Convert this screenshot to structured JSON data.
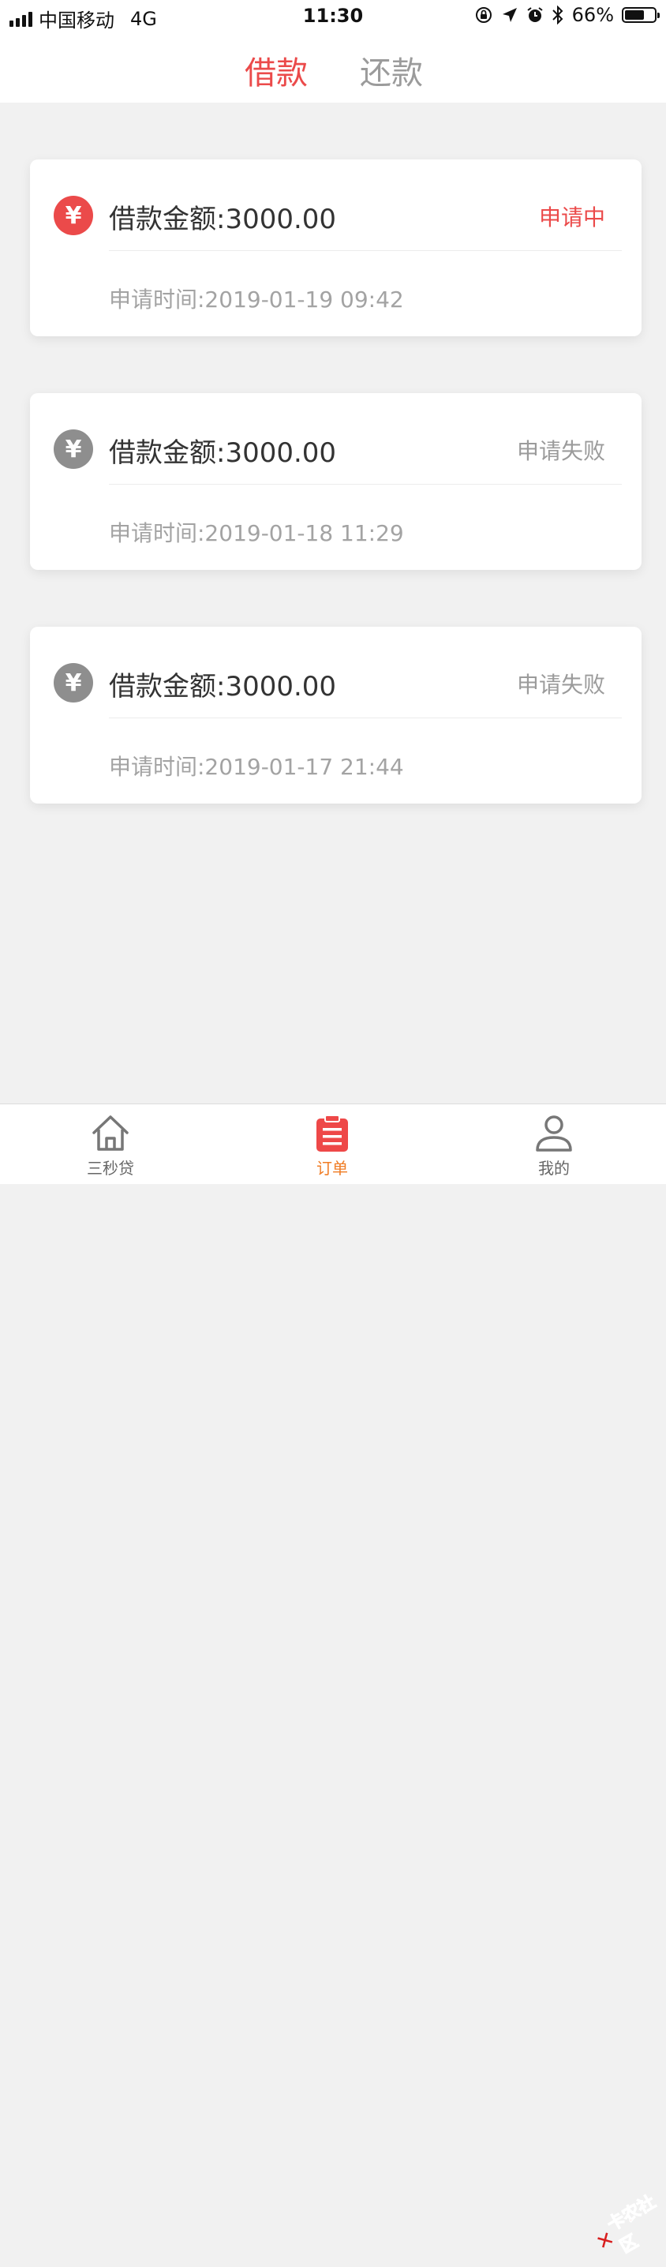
{
  "status_bar": {
    "carrier": "中国移动",
    "network": "4G",
    "time": "11:30",
    "battery": "66%",
    "battery_level": 0.66
  },
  "top_tabs": {
    "borrow": "借款",
    "repay": "还款",
    "active": "borrow",
    "active_color": "#eb4a4a",
    "inactive_color": "#9b9b9b"
  },
  "orders": [
    {
      "amount": "借款金额:3000.00",
      "status": "申请中",
      "time": "申请时间:2019-01-19 09:42",
      "icon": "yuan-icon",
      "status_color": "#eb4a4a",
      "icon_color": "#eb4a4a"
    },
    {
      "amount": "借款金额:3000.00",
      "status": "申请失败",
      "time": "申请时间:2019-01-18 11:29",
      "icon": "yuan-icon",
      "status_color": "#9b9b9b",
      "icon_color": "#8e8e8e"
    },
    {
      "amount": "借款金额:3000.00",
      "status": "申请失败",
      "time": "申请时间:2019-01-17 21:44",
      "icon": "yuan-icon",
      "status_color": "#9b9b9b",
      "icon_color": "#8e8e8e"
    }
  ],
  "coin_symbol": "¥",
  "bottom_nav": {
    "home": "三秒贷",
    "orders": "订单",
    "mine": "我的",
    "active": "orders",
    "active_color": "#f07c24",
    "inactive_color": "#666666"
  },
  "watermark": "卡农社区"
}
